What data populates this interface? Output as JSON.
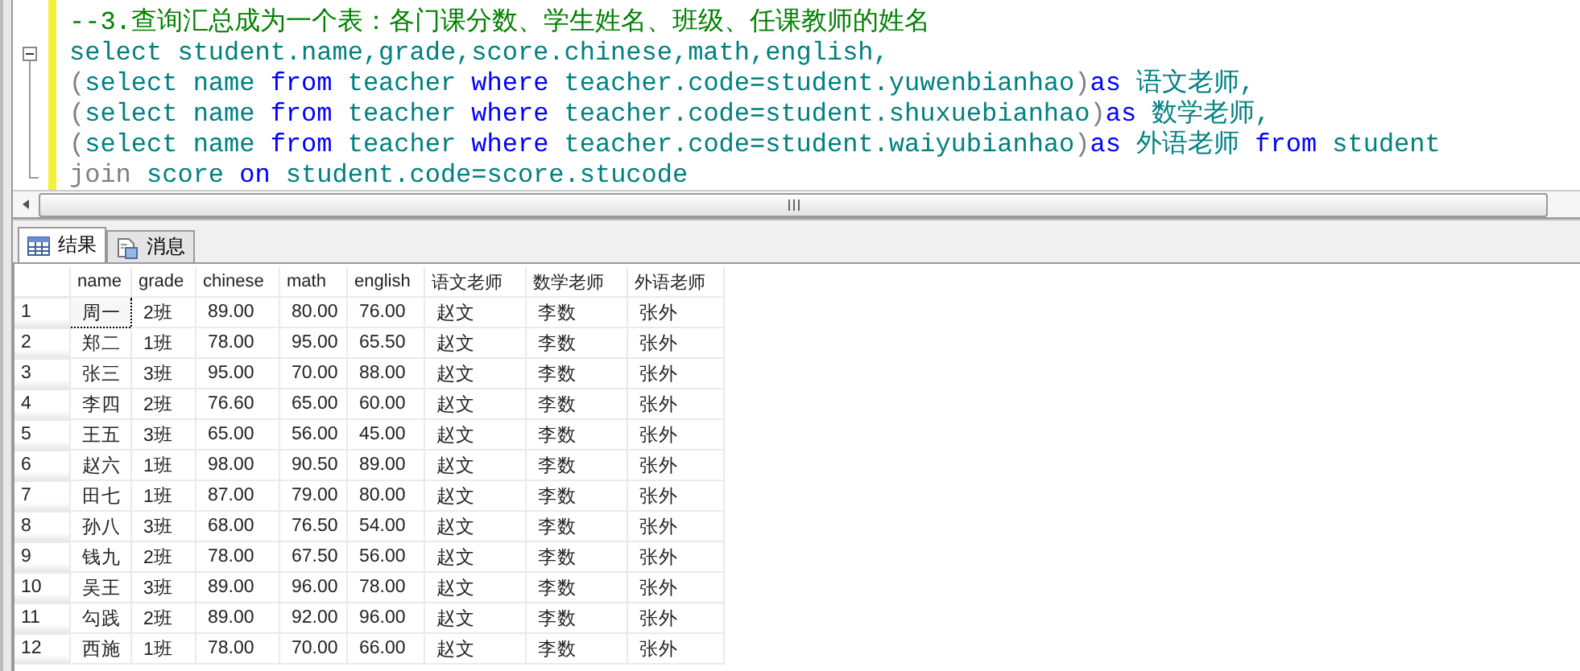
{
  "editor": {
    "lines": [
      {
        "kind": "plain",
        "tokens": [
          {
            "kind": "comment",
            "text": "--3.查询汇总成为一个表：各门课分数、学生姓名、班级、任课教师的姓名"
          }
        ]
      },
      {
        "kind": "fold-start",
        "tokens": [
          {
            "kind": "ident",
            "text": "select student.name,grade,score.chinese,math,english,"
          }
        ]
      },
      {
        "kind": "fold-body",
        "tokens": [
          {
            "kind": "punct",
            "text": "("
          },
          {
            "kind": "ident",
            "text": "select name "
          },
          {
            "kind": "keyword",
            "text": "from"
          },
          {
            "kind": "ident",
            "text": " teacher "
          },
          {
            "kind": "keyword",
            "text": "where"
          },
          {
            "kind": "ident",
            "text": " teacher.code=student.yuwenbianhao"
          },
          {
            "kind": "punct",
            "text": ")"
          },
          {
            "kind": "keyword",
            "text": "as"
          },
          {
            "kind": "ident",
            "text": " 语文老师,"
          }
        ]
      },
      {
        "kind": "fold-body",
        "tokens": [
          {
            "kind": "punct",
            "text": "("
          },
          {
            "kind": "ident",
            "text": "select name "
          },
          {
            "kind": "keyword",
            "text": "from"
          },
          {
            "kind": "ident",
            "text": " teacher "
          },
          {
            "kind": "keyword",
            "text": "where"
          },
          {
            "kind": "ident",
            "text": " teacher.code=student.shuxuebianhao"
          },
          {
            "kind": "punct",
            "text": ")"
          },
          {
            "kind": "keyword",
            "text": "as"
          },
          {
            "kind": "ident",
            "text": " 数学老师,"
          }
        ]
      },
      {
        "kind": "fold-body",
        "tokens": [
          {
            "kind": "punct",
            "text": "("
          },
          {
            "kind": "ident",
            "text": "select name "
          },
          {
            "kind": "keyword",
            "text": "from"
          },
          {
            "kind": "ident",
            "text": " teacher "
          },
          {
            "kind": "keyword",
            "text": "where"
          },
          {
            "kind": "ident",
            "text": " teacher.code=student.waiyubianhao"
          },
          {
            "kind": "punct",
            "text": ")"
          },
          {
            "kind": "keyword",
            "text": "as"
          },
          {
            "kind": "ident",
            "text": " 外语老师 "
          },
          {
            "kind": "keyword",
            "text": "from"
          },
          {
            "kind": "ident",
            "text": " student"
          }
        ]
      },
      {
        "kind": "fold-end",
        "tokens": [
          {
            "kind": "punct",
            "text": "join"
          },
          {
            "kind": "ident",
            "text": " score "
          },
          {
            "kind": "keyword",
            "text": "on"
          },
          {
            "kind": "ident",
            "text": " student.code=score.stucode"
          }
        ]
      }
    ]
  },
  "tabs": [
    {
      "label": "结果",
      "selected": true
    },
    {
      "label": "消息",
      "selected": false
    }
  ],
  "table": {
    "columns": [
      "name",
      "grade",
      "chinese",
      "math",
      "english",
      "语文老师",
      "数学老师",
      "外语老师"
    ],
    "rows": [
      {
        "number": "1",
        "focused": true,
        "cells": [
          "周一",
          "2班",
          "89.00",
          "80.00",
          "76.00",
          "赵文",
          "李数",
          "张外"
        ]
      },
      {
        "number": "2",
        "focused": false,
        "cells": [
          "郑二",
          "1班",
          "78.00",
          "95.00",
          "65.50",
          "赵文",
          "李数",
          "张外"
        ]
      },
      {
        "number": "3",
        "focused": false,
        "cells": [
          "张三",
          "3班",
          "95.00",
          "70.00",
          "88.00",
          "赵文",
          "李数",
          "张外"
        ]
      },
      {
        "number": "4",
        "focused": false,
        "cells": [
          "李四",
          "2班",
          "76.60",
          "65.00",
          "60.00",
          "赵文",
          "李数",
          "张外"
        ]
      },
      {
        "number": "5",
        "focused": false,
        "cells": [
          "王五",
          "3班",
          "65.00",
          "56.00",
          "45.00",
          "赵文",
          "李数",
          "张外"
        ]
      },
      {
        "number": "6",
        "focused": false,
        "cells": [
          "赵六",
          "1班",
          "98.00",
          "90.50",
          "89.00",
          "赵文",
          "李数",
          "张外"
        ]
      },
      {
        "number": "7",
        "focused": false,
        "cells": [
          "田七",
          "1班",
          "87.00",
          "79.00",
          "80.00",
          "赵文",
          "李数",
          "张外"
        ]
      },
      {
        "number": "8",
        "focused": false,
        "cells": [
          "孙八",
          "3班",
          "68.00",
          "76.50",
          "54.00",
          "赵文",
          "李数",
          "张外"
        ]
      },
      {
        "number": "9",
        "focused": false,
        "cells": [
          "钱九",
          "2班",
          "78.00",
          "67.50",
          "56.00",
          "赵文",
          "李数",
          "张外"
        ]
      },
      {
        "number": "10",
        "focused": false,
        "cells": [
          "吴王",
          "3班",
          "89.00",
          "96.00",
          "78.00",
          "赵文",
          "李数",
          "张外"
        ]
      },
      {
        "number": "11",
        "focused": false,
        "cells": [
          "勾践",
          "2班",
          "89.00",
          "92.00",
          "96.00",
          "赵文",
          "李数",
          "张外"
        ]
      },
      {
        "number": "12",
        "focused": false,
        "cells": [
          "西施",
          "1班",
          "78.00",
          "70.00",
          "66.00",
          "赵文",
          "李数",
          "张外"
        ]
      }
    ]
  }
}
